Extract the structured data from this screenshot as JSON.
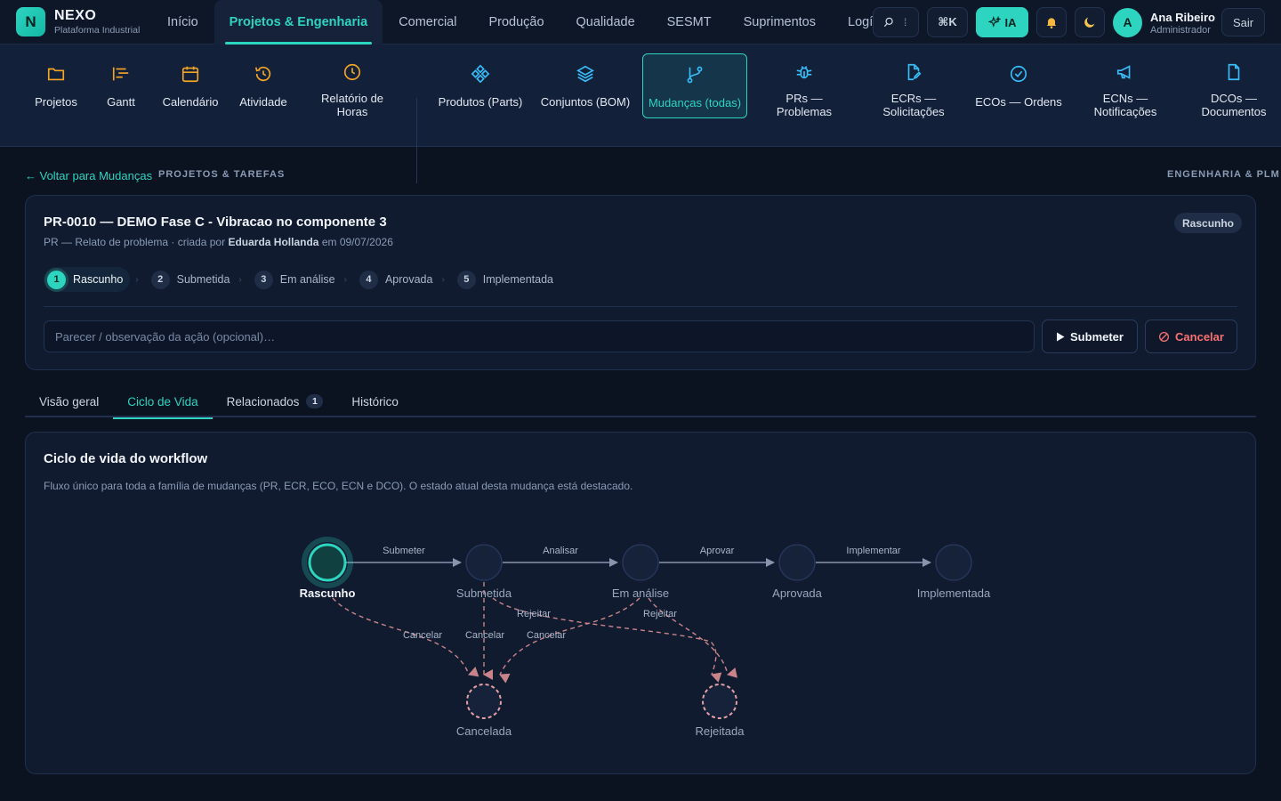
{
  "brand": {
    "logo_letter": "N",
    "name": "NEXO",
    "subtitle": "Plataforma Industrial"
  },
  "nav": {
    "items": [
      {
        "label": "Início"
      },
      {
        "label": "Projetos & Engenharia",
        "active": true
      },
      {
        "label": "Comercial"
      },
      {
        "label": "Produção"
      },
      {
        "label": "Qualidade"
      },
      {
        "label": "SESMT"
      },
      {
        "label": "Suprimentos"
      },
      {
        "label": "Logíst"
      }
    ]
  },
  "top_actions": {
    "search_icon": "search-icon",
    "kbd_shortcut": "⌘K",
    "ai_label": "IA",
    "notifications_icon": "bell-icon",
    "theme_icon": "moon-icon"
  },
  "user": {
    "initial": "A",
    "name": "Ana Ribeiro",
    "role": "Administrador",
    "logout_label": "Sair"
  },
  "subnav": {
    "groups": [
      {
        "label": "PROJETOS & TAREFAS"
      },
      {
        "label": "ENGENHARIA & PLM"
      }
    ],
    "items": [
      {
        "label": "Projetos",
        "icon": "folder-icon"
      },
      {
        "label": "Gantt",
        "icon": "gantt-icon"
      },
      {
        "label": "Calendário",
        "icon": "calendar-icon"
      },
      {
        "label": "Atividade",
        "icon": "history-icon"
      },
      {
        "label": "Relatório de Horas",
        "icon": "clock-icon"
      },
      {
        "label": "Produtos (Parts)",
        "icon": "component-icon"
      },
      {
        "label": "Conjuntos (BOM)",
        "icon": "layers-icon"
      },
      {
        "label": "Mudanças (todas)",
        "icon": "git-branch-icon",
        "active": true
      },
      {
        "label": "PRs — Problemas",
        "icon": "bug-icon"
      },
      {
        "label": "ECRs — Solicitações",
        "icon": "file-edit-icon"
      },
      {
        "label": "ECOs — Ordens",
        "icon": "check-circle-icon"
      },
      {
        "label": "ECNs — Notificações",
        "icon": "megaphone-icon"
      },
      {
        "label": "DCOs — Documentos",
        "icon": "file-icon"
      }
    ]
  },
  "page": {
    "back_link": "← Voltar para Mudanças",
    "title": "PR-0010 — DEMO Fase C - Vibracao no componente 3",
    "meta_prefix": "PR — Relato de problema · criada por",
    "meta_author": "Eduarda Hollanda",
    "meta_suffix": "em 09/07/2026",
    "status": "Rascunho",
    "steps": [
      {
        "num": "1",
        "label": "Rascunho",
        "current": true
      },
      {
        "num": "2",
        "label": "Submetida"
      },
      {
        "num": "3",
        "label": "Em análise"
      },
      {
        "num": "4",
        "label": "Aprovada"
      },
      {
        "num": "5",
        "label": "Implementada"
      }
    ],
    "step_separator": "›",
    "note_placeholder": "Parecer / observação da ação (opcional)…",
    "submit_label": "Submeter",
    "cancel_label": "Cancelar"
  },
  "tabs": [
    {
      "label": "Visão geral"
    },
    {
      "label": "Ciclo de Vida",
      "active": true
    },
    {
      "label": "Relacionados",
      "count": "1"
    },
    {
      "label": "Histórico"
    }
  ],
  "workflow": {
    "title": "Ciclo de vida do workflow",
    "description": "Fluxo único para toda a família de mudanças (PR, ECR, ECO, ECN e DCO). O estado atual desta mudança está destacado.",
    "states": [
      {
        "label": "Rascunho",
        "current": true
      },
      {
        "label": "Submetida"
      },
      {
        "label": "Em análise"
      },
      {
        "label": "Aprovada"
      },
      {
        "label": "Implementada"
      }
    ],
    "transitions": [
      "Submeter",
      "Analisar",
      "Aprovar",
      "Implementar"
    ],
    "terminal_states": [
      {
        "label": "Cancelada"
      },
      {
        "label": "Rejeitada"
      }
    ],
    "cancel_label": "Cancelar",
    "reject_label": "Rejeitar"
  },
  "colors": {
    "accent": "#2dd4bf",
    "danger": "#f87171",
    "terminal_dashed": "#c9848a",
    "background": "#0b1220"
  }
}
